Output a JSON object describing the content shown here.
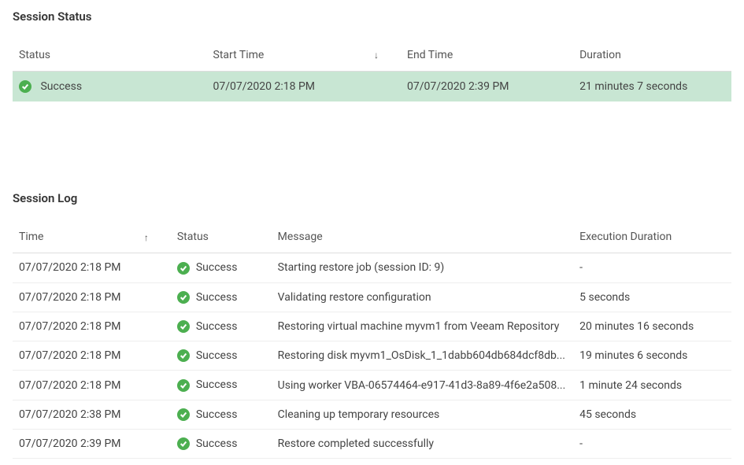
{
  "sessionStatus": {
    "title": "Session Status",
    "columns": {
      "status": "Status",
      "startTime": "Start Time",
      "endTime": "End Time",
      "duration": "Duration"
    },
    "row": {
      "status": "Success",
      "startTime": "07/07/2020 2:18 PM",
      "endTime": "07/07/2020 2:39 PM",
      "duration": "21 minutes 7 seconds"
    }
  },
  "sessionLog": {
    "title": "Session Log",
    "columns": {
      "time": "Time",
      "status": "Status",
      "message": "Message",
      "execDuration": "Execution Duration"
    },
    "rows": [
      {
        "time": "07/07/2020 2:18 PM",
        "status": "Success",
        "message": "Starting restore job (session ID: 9)",
        "execDuration": "-"
      },
      {
        "time": "07/07/2020 2:18 PM",
        "status": "Success",
        "message": "Validating restore configuration",
        "execDuration": "5 seconds"
      },
      {
        "time": "07/07/2020 2:18 PM",
        "status": "Success",
        "message": "Restoring virtual machine myvm1 from Veeam Repository",
        "execDuration": "20 minutes 16 seconds"
      },
      {
        "time": "07/07/2020 2:18 PM",
        "status": "Success",
        "message": "Restoring disk myvm1_OsDisk_1_1dabb604db684dcf8db...",
        "execDuration": "19 minutes 6 seconds"
      },
      {
        "time": "07/07/2020 2:18 PM",
        "status": "Success",
        "message": "Using worker VBA-06574464-e917-41d3-8a89-4f6e2a508...",
        "execDuration": "1 minute 24 seconds"
      },
      {
        "time": "07/07/2020 2:38 PM",
        "status": "Success",
        "message": "Cleaning up temporary resources",
        "execDuration": "45 seconds"
      },
      {
        "time": "07/07/2020 2:39 PM",
        "status": "Success",
        "message": "Restore completed successfully",
        "execDuration": "-"
      }
    ]
  }
}
